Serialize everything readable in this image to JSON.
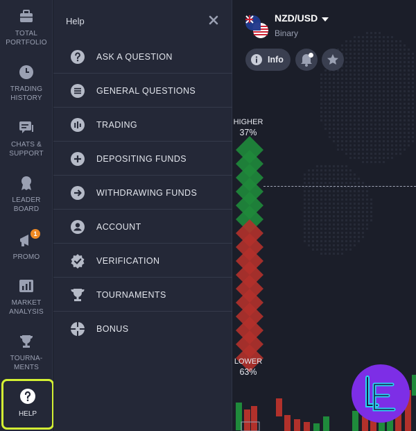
{
  "sidebar": {
    "items": [
      {
        "label": "TOTAL\nPORTFOLIO",
        "icon": "briefcase-icon"
      },
      {
        "label": "TRADING\nHISTORY",
        "icon": "clock-icon"
      },
      {
        "label": "CHATS &\nSUPPORT",
        "icon": "chat-icon"
      },
      {
        "label": "LEADER\nBOARD",
        "icon": "medal-icon"
      },
      {
        "label": "PROMO",
        "icon": "megaphone-icon",
        "badge": "1"
      },
      {
        "label": "MARKET\nANALYSIS",
        "icon": "bar-chart-icon"
      },
      {
        "label": "TOURNA-\nMENTS",
        "icon": "trophy-icon"
      },
      {
        "label": "HELP",
        "icon": "question-icon"
      }
    ],
    "highlight_color": "#d4f133"
  },
  "help_panel": {
    "title": "Help",
    "items": [
      {
        "label": "ASK A QUESTION",
        "icon": "question-circle-icon"
      },
      {
        "label": "GENERAL QUESTIONS",
        "icon": "list-icon"
      },
      {
        "label": "TRADING",
        "icon": "candles-icon"
      },
      {
        "label": "DEPOSITING FUNDS",
        "icon": "plus-circle-icon"
      },
      {
        "label": "WITHDRAWING FUNDS",
        "icon": "arrow-right-circle-icon"
      },
      {
        "label": "ACCOUNT",
        "icon": "user-circle-icon"
      },
      {
        "label": "VERIFICATION",
        "icon": "verified-badge-icon"
      },
      {
        "label": "TOURNAMENTS",
        "icon": "trophy-icon"
      },
      {
        "label": "BONUS",
        "icon": "gift-icon"
      }
    ]
  },
  "asset": {
    "pair": "NZD/USD",
    "type": "Binary",
    "info_label": "Info"
  },
  "sentiment": {
    "higher_label": "HIGHER",
    "higher_pct": "37%",
    "lower_label": "LOWER",
    "lower_pct": "63%",
    "higher_value": 37,
    "lower_value": 63,
    "up_color": "#1f8a3b",
    "down_color": "#b2312b"
  }
}
